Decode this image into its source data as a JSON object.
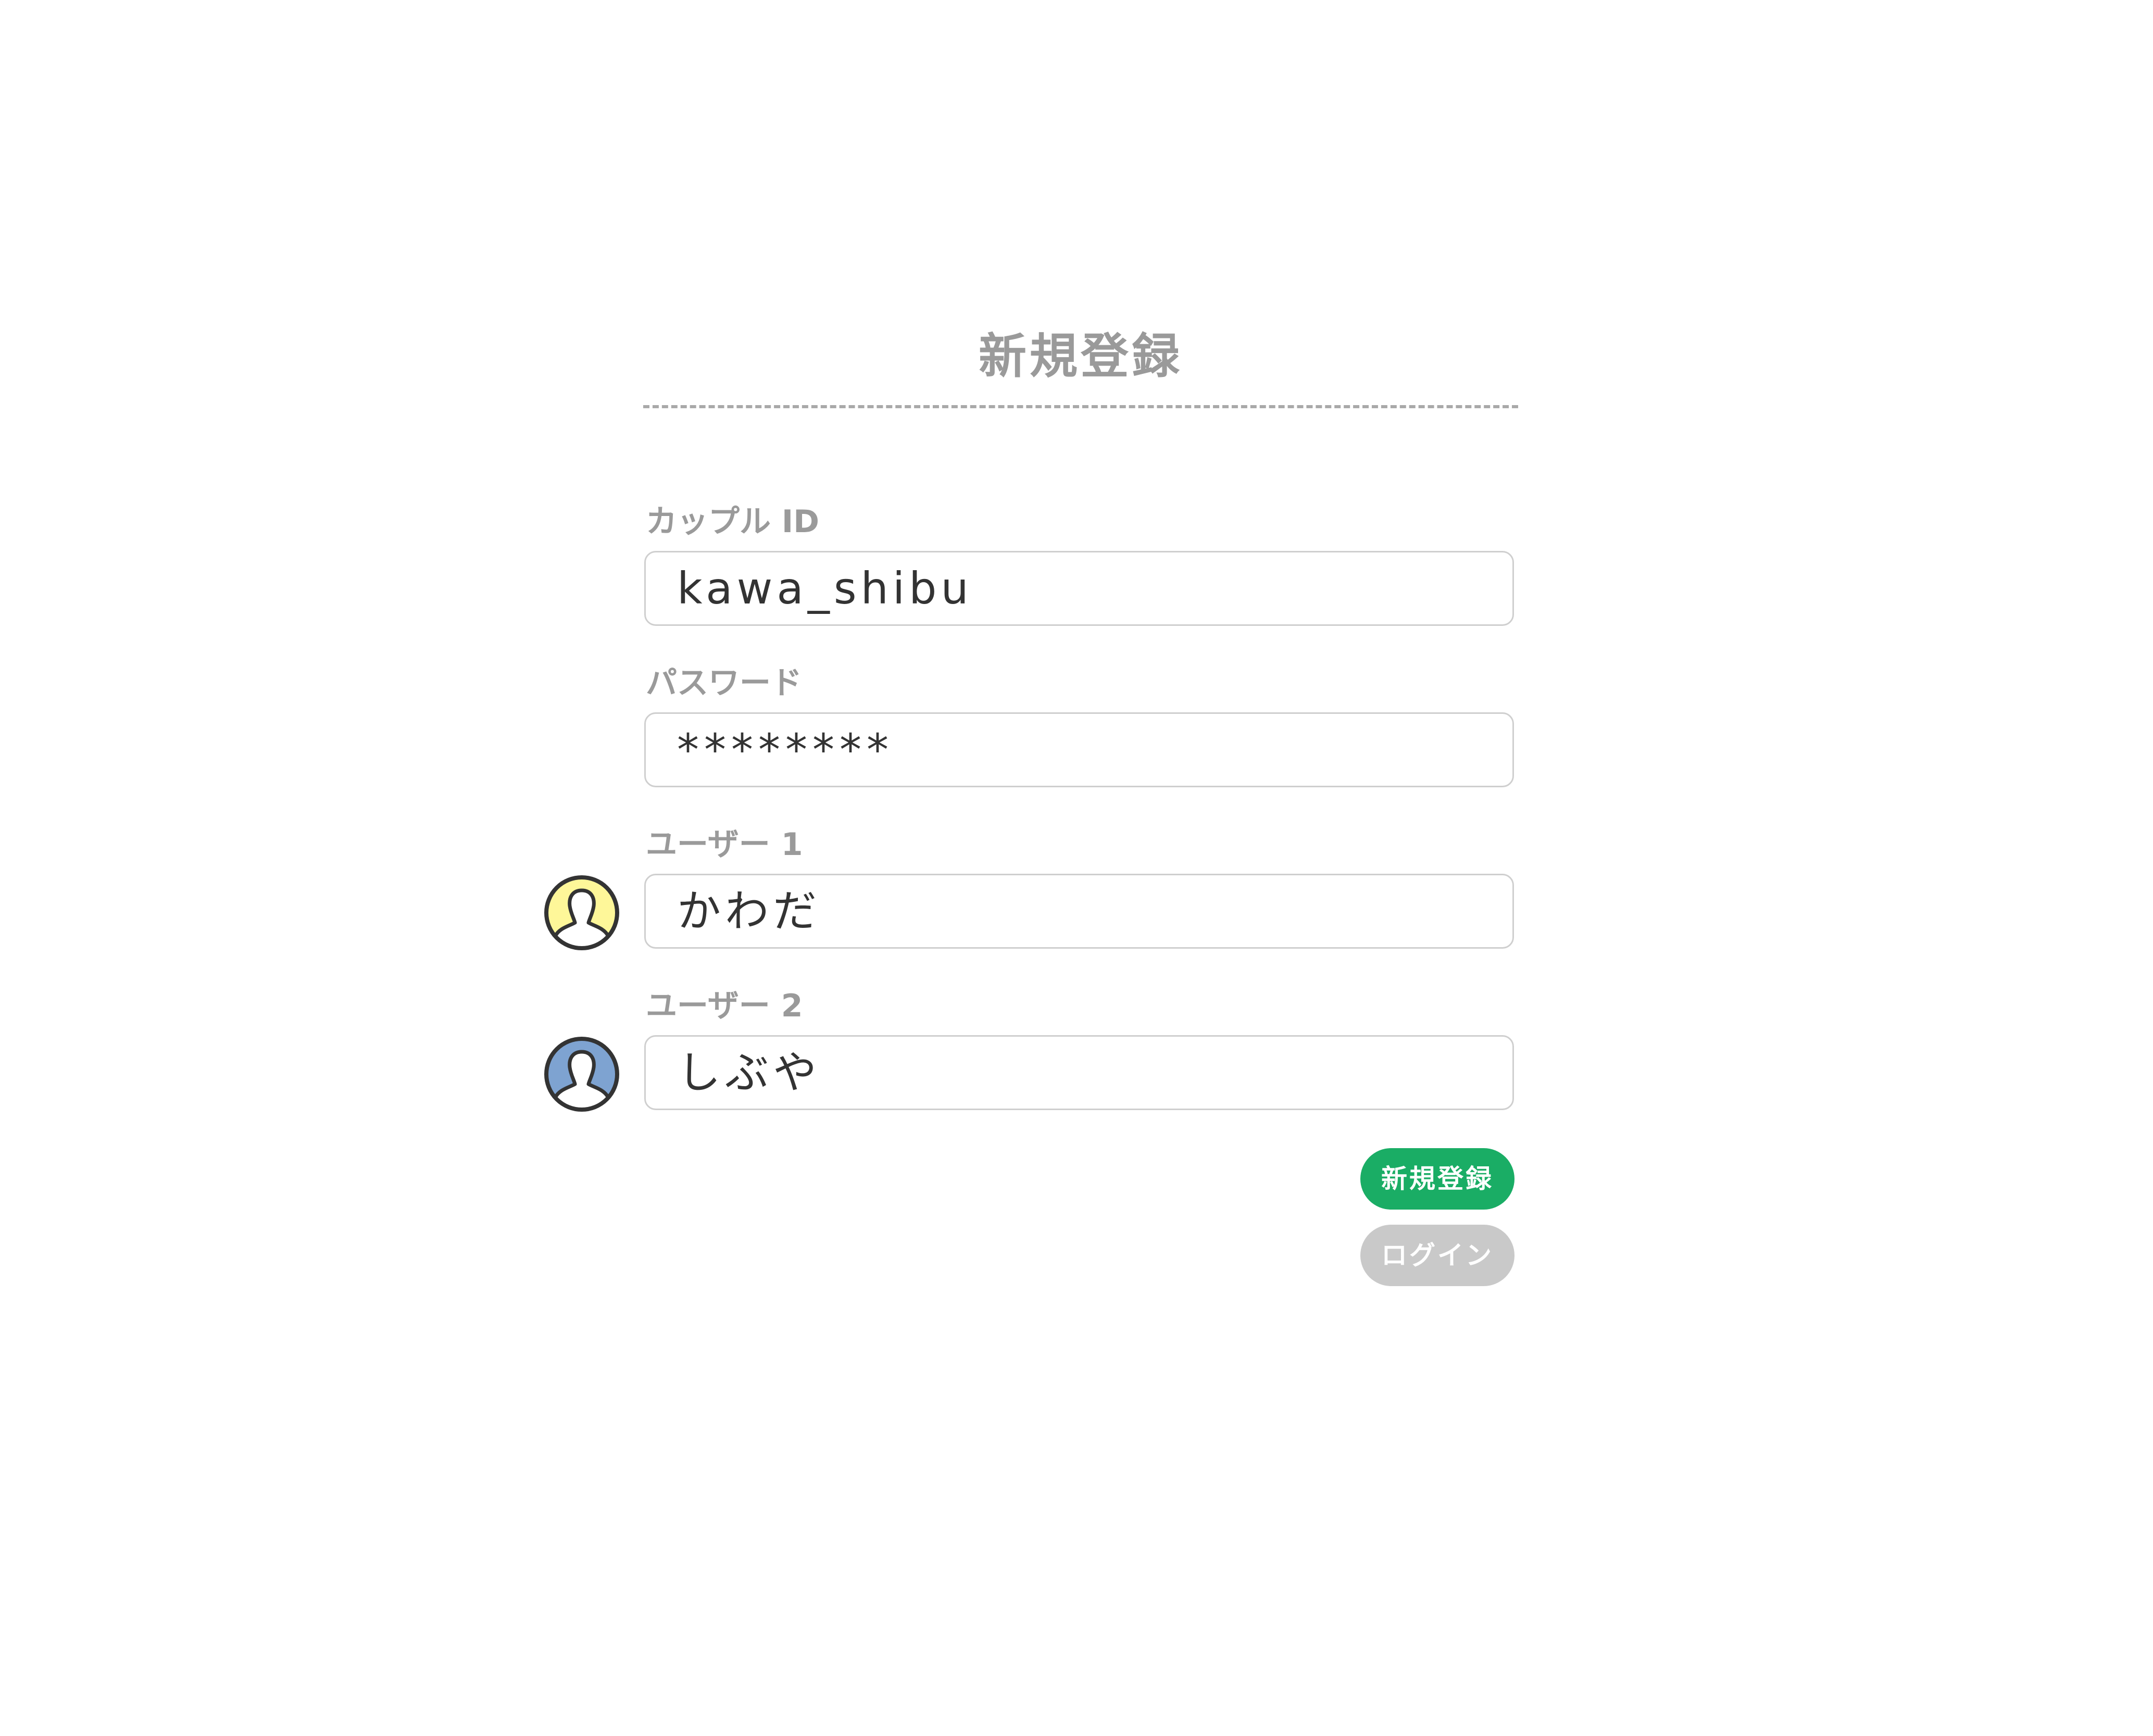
{
  "header": {
    "title": "新規登録"
  },
  "form": {
    "couple_id": {
      "label": "カップル ID",
      "value": "kawa_shibu"
    },
    "password": {
      "label": "パスワード",
      "value": "********"
    },
    "user1": {
      "label": "ユーザー 1",
      "value": "かわだ",
      "avatar_icon": "user-silhouette-icon",
      "avatar_color": "#fef799"
    },
    "user2": {
      "label": "ユーザー 2",
      "value": "しぶや",
      "avatar_icon": "user-silhouette-icon",
      "avatar_color": "#7ea3d1"
    }
  },
  "actions": {
    "register_label": "新規登録",
    "register_color": "#1aad65",
    "login_label": "ログイン",
    "login_color": "#c9c9c9"
  }
}
